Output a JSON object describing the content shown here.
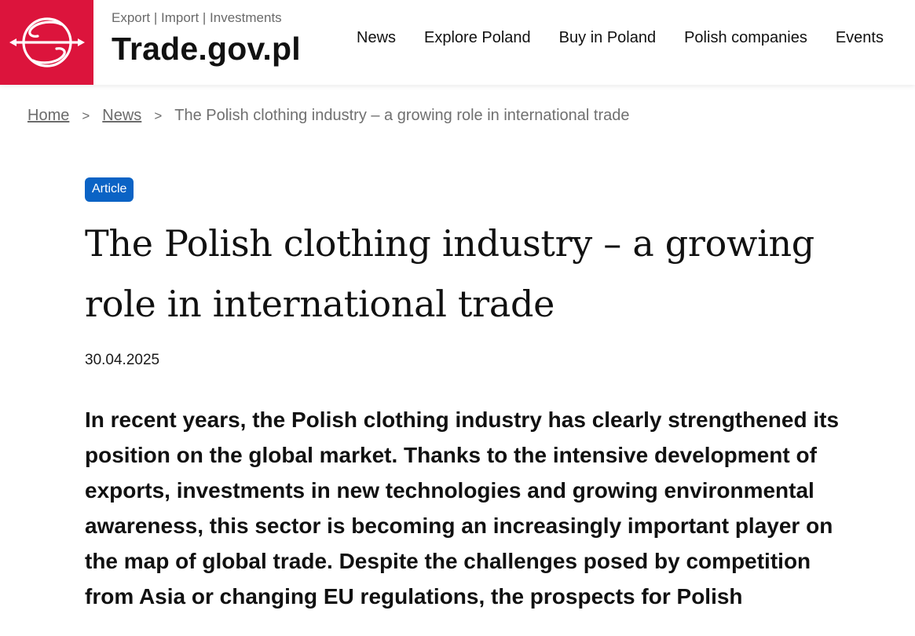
{
  "header": {
    "tagline": "Export | Import | Investments",
    "site_name": "Trade.gov.pl",
    "logo_color": "#dc143c",
    "nav": [
      "News",
      "Explore Poland",
      "Buy in Poland",
      "Polish companies",
      "Events"
    ]
  },
  "breadcrumb": {
    "home": "Home",
    "separator": ">",
    "news": "News",
    "current": "The Polish clothing industry – a growing role in international trade"
  },
  "article": {
    "badge": "Article",
    "badge_color": "#0b63c5",
    "title": "The Polish clothing industry – a growing role in international trade",
    "date": "30.04.2025",
    "lead": "In recent years, the Polish clothing industry has clearly strengthened its position on the global market. Thanks to the intensive development of exports, investments in new technologies and growing environmental awareness, this sector is becoming an increasingly important player on the map of global trade. Despite the challenges posed by competition from Asia or changing EU regulations, the prospects for Polish"
  }
}
